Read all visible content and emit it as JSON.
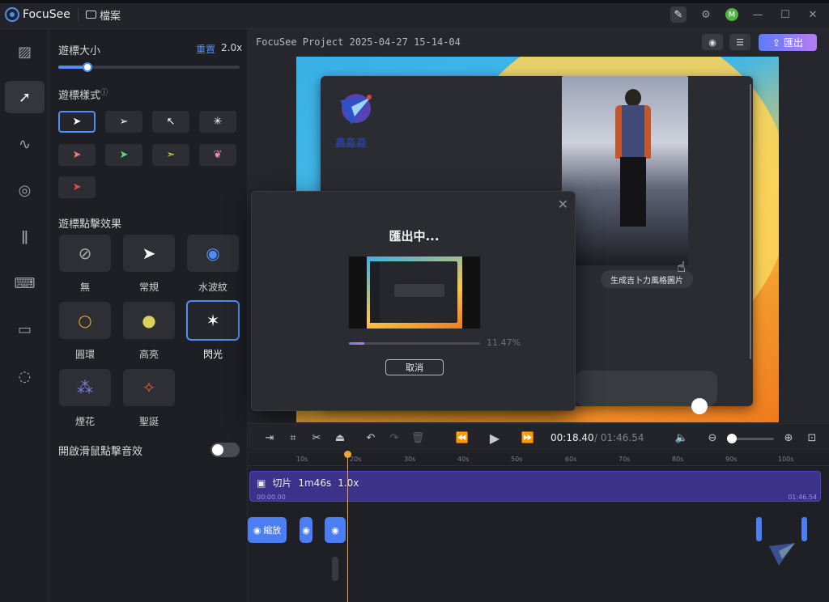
{
  "app": {
    "name": "FocuSee",
    "file_menu": "檔案"
  },
  "project": {
    "title": "FocuSee Project 2025-04-27 15-14-04",
    "export_label": "匯出"
  },
  "panel": {
    "cursor_size": {
      "title": "遊標大小",
      "reset": "重置",
      "value": "2.0x",
      "slider_fraction": 0.16
    },
    "cursor_style": {
      "title": "遊標樣式",
      "info": "?"
    },
    "click_effect": {
      "title": "遊標點擊效果",
      "items": [
        {
          "label": "無",
          "icon": "no-icon"
        },
        {
          "label": "常規",
          "icon": "pointer-icon"
        },
        {
          "label": "水波紋",
          "icon": "ripple-icon"
        },
        {
          "label": "圓環",
          "icon": "ring-icon"
        },
        {
          "label": "高亮",
          "icon": "highlight-icon"
        },
        {
          "label": "閃光",
          "icon": "flash-icon"
        },
        {
          "label": "煙花",
          "icon": "firework-icon"
        },
        {
          "label": "聖誕",
          "icon": "christmas-icon"
        }
      ],
      "selected": "閃光"
    },
    "click_sound": {
      "label": "開啟滑鼠點擊音效",
      "enabled": false
    }
  },
  "canvas": {
    "inner_logo_text": "鑫淼淼",
    "photo_caption": "生成吉卜力風格圖片"
  },
  "export_modal": {
    "title": "匯出中...",
    "progress_text": "11.47%",
    "progress_fraction": 0.1147,
    "cancel_label": "取消",
    "thumb_dialog_text": "匯出中"
  },
  "playback": {
    "current": "00:18.40",
    "total": "/ 01:46.54"
  },
  "timeline": {
    "ticks": [
      "10s",
      "20s",
      "30s",
      "40s",
      "50s",
      "60s",
      "70s",
      "80s",
      "90s",
      "100s"
    ],
    "clip": {
      "label": "切片",
      "duration": "1m46s",
      "speed": "1.0x",
      "start": "00:00.00",
      "end": "01:46.54"
    },
    "zoom_label": "縮放"
  },
  "colors": {
    "accent": "#4f8ef7",
    "clip": "#3c3289",
    "playhead": "#f0a336"
  }
}
